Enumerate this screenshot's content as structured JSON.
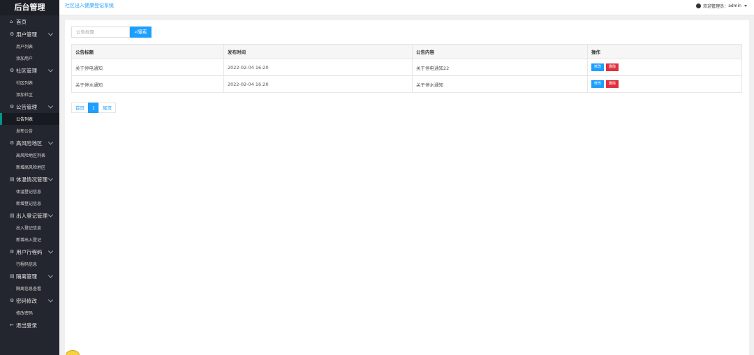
{
  "app": {
    "title": "后台管理",
    "system_name": "社区出入健康登记系统"
  },
  "header": {
    "welcome": "欢迎管理员：",
    "user": "admin"
  },
  "sidebar": {
    "items": [
      {
        "type": "group",
        "icon": "home-icon",
        "glyph": "⌂",
        "label": "首页",
        "chevron": false
      },
      {
        "type": "group",
        "icon": "gear-icon",
        "glyph": "⚙",
        "label": "用户管理",
        "chevron": true
      },
      {
        "type": "sub",
        "label": "用户列表"
      },
      {
        "type": "sub",
        "label": "添加用户"
      },
      {
        "type": "group",
        "icon": "gear-icon",
        "glyph": "⚙",
        "label": "社区管理",
        "chevron": true
      },
      {
        "type": "sub",
        "label": "社区列表"
      },
      {
        "type": "sub",
        "label": "添加社区"
      },
      {
        "type": "group",
        "icon": "gear-icon",
        "glyph": "⚙",
        "label": "公告管理",
        "chevron": true
      },
      {
        "type": "sub",
        "label": "公告列表",
        "active": true
      },
      {
        "type": "sub",
        "label": "发布公告"
      },
      {
        "type": "group",
        "icon": "gear-icon",
        "glyph": "⚙",
        "label": "高风险地区",
        "chevron": true
      },
      {
        "type": "sub",
        "label": "高风险地区列表"
      },
      {
        "type": "sub",
        "label": "新增高风险地区"
      },
      {
        "type": "group",
        "icon": "document-icon",
        "glyph": "▤",
        "label": "体温情况管理",
        "chevron": true
      },
      {
        "type": "sub",
        "label": "体温登记信息"
      },
      {
        "type": "sub",
        "label": "新增登记信息"
      },
      {
        "type": "group",
        "icon": "document-icon",
        "glyph": "▤",
        "label": "出入登记管理",
        "chevron": true
      },
      {
        "type": "sub",
        "label": "出入登记信息"
      },
      {
        "type": "sub",
        "label": "新增出入登记"
      },
      {
        "type": "group",
        "icon": "gear-icon",
        "glyph": "⚙",
        "label": "用户行程码",
        "chevron": true
      },
      {
        "type": "sub",
        "label": "行程码信息"
      },
      {
        "type": "group",
        "icon": "document-icon",
        "glyph": "▤",
        "label": "隔离管理",
        "chevron": true
      },
      {
        "type": "sub",
        "label": "隔离信息查看"
      },
      {
        "type": "group",
        "icon": "gear-icon",
        "glyph": "⚙",
        "label": "密码修改",
        "chevron": true
      },
      {
        "type": "sub",
        "label": "修改密码"
      },
      {
        "type": "group",
        "icon": "logout-icon",
        "glyph": "←",
        "label": "退出登录",
        "chevron": false
      }
    ]
  },
  "search": {
    "placeholder": "公告标题",
    "button_label": "搜索"
  },
  "table": {
    "columns": [
      "公告标题",
      "发布时间",
      "公告内容",
      "操作"
    ],
    "rows": [
      {
        "title": "关于停电通知",
        "time": "2022-02-04 16:20",
        "content": "关于停电通知22"
      },
      {
        "title": "关于停水通知",
        "time": "2022-02-04 16:20",
        "content": "关于停水通知"
      }
    ],
    "edit_label": "修改",
    "delete_label": "删除"
  },
  "pager": {
    "first": "首页",
    "current": "1",
    "last": "尾页"
  }
}
